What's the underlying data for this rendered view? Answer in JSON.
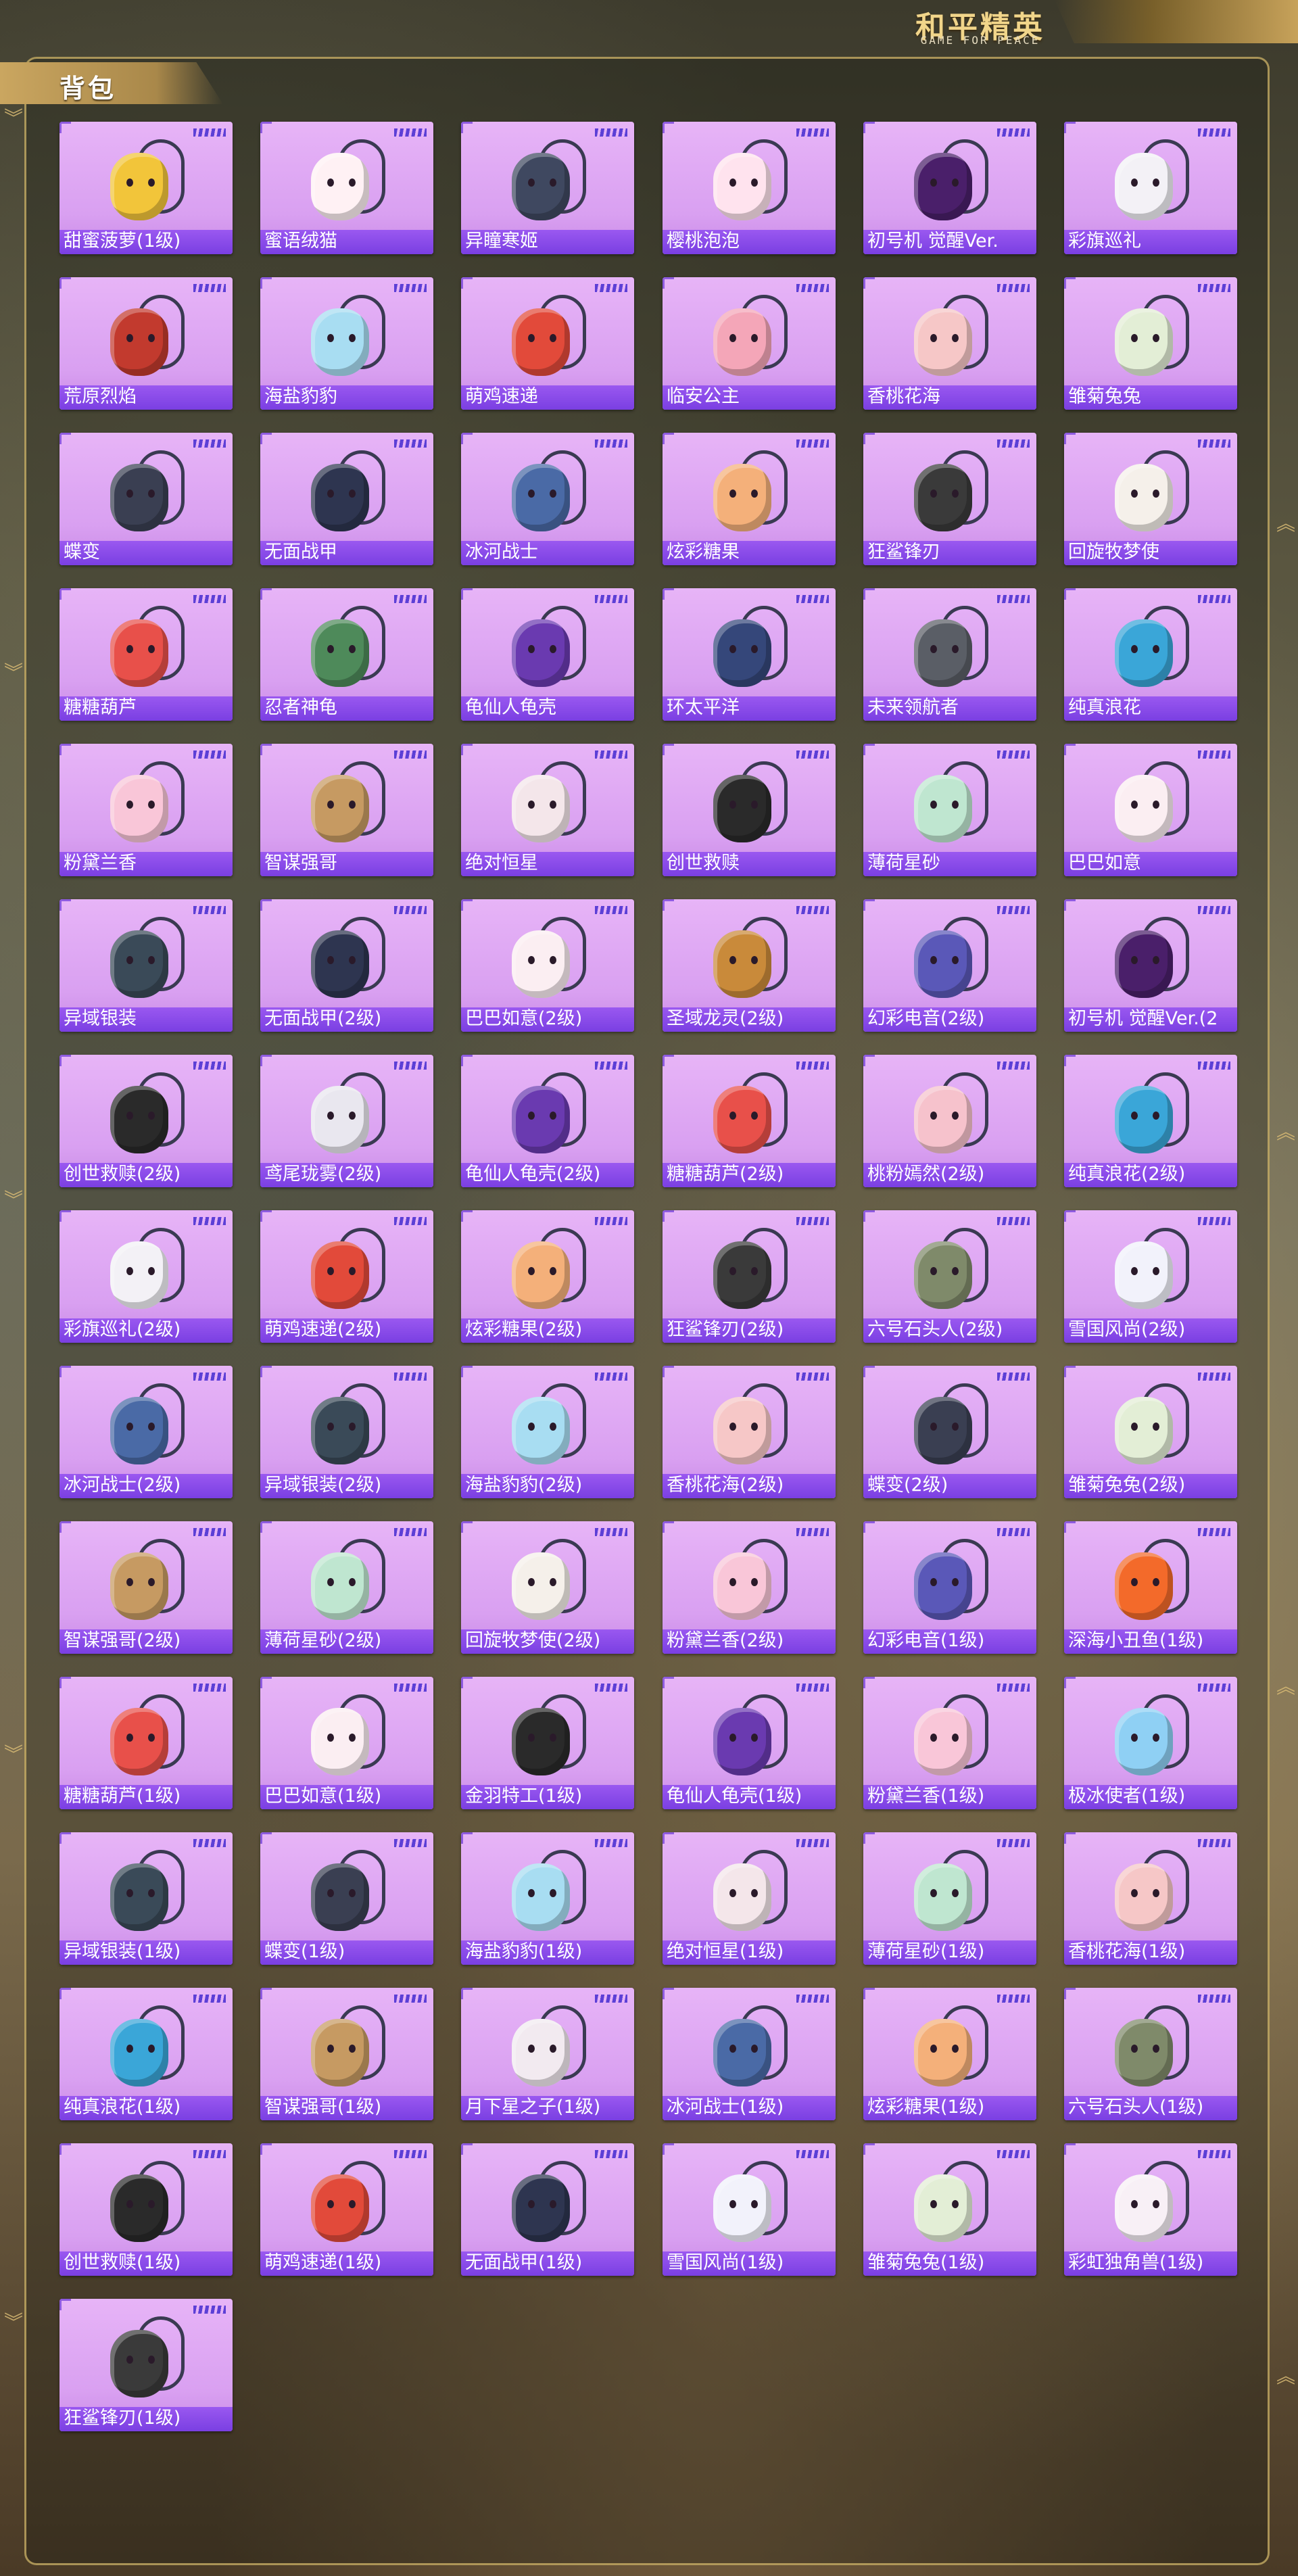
{
  "brand": {
    "title": "和平精英",
    "subtitle": "GAME FOR PEACE"
  },
  "section": {
    "title": "背包"
  },
  "items": [
    {
      "label": "甜蜜菠萝(1级)",
      "color": "#f2c53a"
    },
    {
      "label": "蜜语绒猫",
      "color": "#fff1f4"
    },
    {
      "label": "异瞳寒姬",
      "color": "#3f4860"
    },
    {
      "label": "樱桃泡泡",
      "color": "#ffe3ee"
    },
    {
      "label": "初号机 觉醒Ver.",
      "color": "#4a1f6a"
    },
    {
      "label": "彩旗巡礼",
      "color": "#f3f1f6"
    },
    {
      "label": "荒原烈焰",
      "color": "#c23a2e"
    },
    {
      "label": "海盐豹豹",
      "color": "#a8ddf2"
    },
    {
      "label": "萌鸡速递",
      "color": "#e24a3a"
    },
    {
      "label": "临安公主",
      "color": "#f4a6b8"
    },
    {
      "label": "香桃花海",
      "color": "#f6c7c7"
    },
    {
      "label": "雏菊兔兔",
      "color": "#e3eed6"
    },
    {
      "label": "蝶变",
      "color": "#3a3f52"
    },
    {
      "label": "无面战甲",
      "color": "#2e3550"
    },
    {
      "label": "冰河战士",
      "color": "#4a6aa6"
    },
    {
      "label": "炫彩糖果",
      "color": "#f4b07a"
    },
    {
      "label": "狂鲨锋刃",
      "color": "#3a3a3a"
    },
    {
      "label": "回旋牧梦使",
      "color": "#f5f0ea"
    },
    {
      "label": "糖糖葫芦",
      "color": "#e8504a"
    },
    {
      "label": "忍者神龟",
      "color": "#4e8a5a"
    },
    {
      "label": "龟仙人龟壳",
      "color": "#6a3ab0"
    },
    {
      "label": "环太平洋",
      "color": "#35477a"
    },
    {
      "label": "未来领航者",
      "color": "#5a5e66"
    },
    {
      "label": "纯真浪花",
      "color": "#3aa6d8"
    },
    {
      "label": "粉黛兰香",
      "color": "#f9c6d8"
    },
    {
      "label": "智谋强哥",
      "color": "#c69a62"
    },
    {
      "label": "绝对恒星",
      "color": "#f4e6ea"
    },
    {
      "label": "创世救赎",
      "color": "#2a2a2a"
    },
    {
      "label": "薄荷星砂",
      "color": "#bfe6d0"
    },
    {
      "label": "巴巴如意",
      "color": "#fbeef2"
    },
    {
      "label": "异域银装",
      "color": "#3a4a58"
    },
    {
      "label": "无面战甲(2级)",
      "color": "#2e3550"
    },
    {
      "label": "巴巴如意(2级)",
      "color": "#fbeef2"
    },
    {
      "label": "圣域龙灵(2级)",
      "color": "#c98a3a"
    },
    {
      "label": "幻彩电音(2级)",
      "color": "#5a58b8"
    },
    {
      "label": "初号机 觉醒Ver.(2",
      "color": "#4a1f6a"
    },
    {
      "label": "创世救赎(2级)",
      "color": "#2a2a2a"
    },
    {
      "label": "鸢尾珑雾(2级)",
      "color": "#e9e7ef"
    },
    {
      "label": "龟仙人龟壳(2级)",
      "color": "#6a3ab0"
    },
    {
      "label": "糖糖葫芦(2级)",
      "color": "#e8504a"
    },
    {
      "label": "桃粉嫣然(2级)",
      "color": "#f6c2cc"
    },
    {
      "label": "纯真浪花(2级)",
      "color": "#3aa6d8"
    },
    {
      "label": "彩旗巡礼(2级)",
      "color": "#f3f1f6"
    },
    {
      "label": "萌鸡速递(2级)",
      "color": "#e24a3a"
    },
    {
      "label": "炫彩糖果(2级)",
      "color": "#f4b07a"
    },
    {
      "label": "狂鲨锋刃(2级)",
      "color": "#3a3a3a"
    },
    {
      "label": "六号石头人(2级)",
      "color": "#7f8a6a"
    },
    {
      "label": "雪国风尚(2级)",
      "color": "#f2f2fb"
    },
    {
      "label": "冰河战士(2级)",
      "color": "#4a6aa6"
    },
    {
      "label": "异域银装(2级)",
      "color": "#3a4a58"
    },
    {
      "label": "海盐豹豹(2级)",
      "color": "#a8ddf2"
    },
    {
      "label": "香桃花海(2级)",
      "color": "#f6c7c7"
    },
    {
      "label": "蝶变(2级)",
      "color": "#3a3f52"
    },
    {
      "label": "雏菊兔兔(2级)",
      "color": "#e3eed6"
    },
    {
      "label": "智谋强哥(2级)",
      "color": "#c69a62"
    },
    {
      "label": "薄荷星砂(2级)",
      "color": "#bfe6d0"
    },
    {
      "label": "回旋牧梦使(2级)",
      "color": "#f5f0ea"
    },
    {
      "label": "粉黛兰香(2级)",
      "color": "#f9c6d8"
    },
    {
      "label": "幻彩电音(1级)",
      "color": "#5a58b8"
    },
    {
      "label": "深海小丑鱼(1级)",
      "color": "#f36a2a"
    },
    {
      "label": "糖糖葫芦(1级)",
      "color": "#e8504a"
    },
    {
      "label": "巴巴如意(1级)",
      "color": "#fbeef2"
    },
    {
      "label": "金羽特工(1级)",
      "color": "#2a2a2a"
    },
    {
      "label": "龟仙人龟壳(1级)",
      "color": "#6a3ab0"
    },
    {
      "label": "粉黛兰香(1级)",
      "color": "#f9c6d8"
    },
    {
      "label": "极冰使者(1级)",
      "color": "#8fd0f4"
    },
    {
      "label": "异域银装(1级)",
      "color": "#3a4a58"
    },
    {
      "label": "蝶变(1级)",
      "color": "#3a3f52"
    },
    {
      "label": "海盐豹豹(1级)",
      "color": "#a8ddf2"
    },
    {
      "label": "绝对恒星(1级)",
      "color": "#f4e6ea"
    },
    {
      "label": "薄荷星砂(1级)",
      "color": "#bfe6d0"
    },
    {
      "label": "香桃花海(1级)",
      "color": "#f6c7c7"
    },
    {
      "label": "纯真浪花(1级)",
      "color": "#3aa6d8"
    },
    {
      "label": "智谋强哥(1级)",
      "color": "#c69a62"
    },
    {
      "label": "月下星之子(1级)",
      "color": "#f2eaf0"
    },
    {
      "label": "冰河战士(1级)",
      "color": "#4a6aa6"
    },
    {
      "label": "炫彩糖果(1级)",
      "color": "#f4b07a"
    },
    {
      "label": "六号石头人(1级)",
      "color": "#7f8a6a"
    },
    {
      "label": "创世救赎(1级)",
      "color": "#2a2a2a"
    },
    {
      "label": "萌鸡速递(1级)",
      "color": "#e24a3a"
    },
    {
      "label": "无面战甲(1级)",
      "color": "#2e3550"
    },
    {
      "label": "雪国风尚(1级)",
      "color": "#f2f2fb"
    },
    {
      "label": "雏菊兔兔(1级)",
      "color": "#e3eed6"
    },
    {
      "label": "彩虹独角兽(1级)",
      "color": "#f8f0f6"
    },
    {
      "label": "狂鲨锋刃(1级)",
      "color": "#3a3a3a"
    }
  ]
}
